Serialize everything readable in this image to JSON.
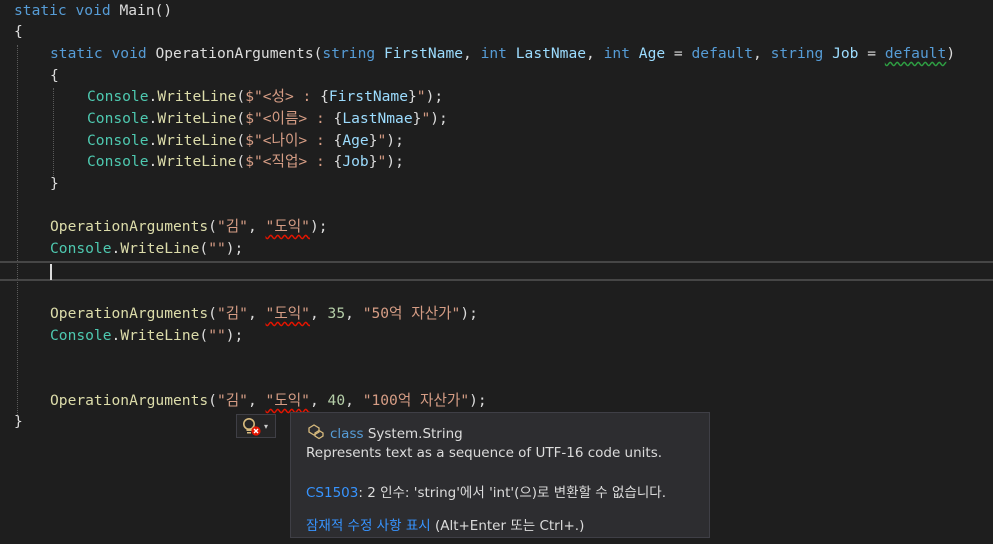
{
  "code": {
    "l1": {
      "static": "static",
      "void": "void",
      "name": "Main",
      "rest": "()"
    },
    "l2": {
      "brace": "{"
    },
    "l3": {
      "static": "static",
      "void": "void",
      "name": "OperationArguments",
      "p0": "(",
      "t1": "string",
      "n1": "FirstName",
      "c1": ", ",
      "t2": "int",
      "n2": "LastNmae",
      "c2": ", ",
      "t3": "int",
      "n3": "Age",
      "eq1": " = ",
      "d1": "default",
      "c3": ", ",
      "t4": "string",
      "n4": "Job",
      "eq2": " = ",
      "d2": "default",
      "p1": ")"
    },
    "l4": {
      "brace": "{"
    },
    "l5": {
      "cls": "Console",
      "dot": ".",
      "m": "WriteLine",
      "open": "(",
      "s1": "$\"<성> : ",
      "lb": "{",
      "v": "FirstName",
      "rb": "}",
      "s2": "\"",
      "close": ");"
    },
    "l6": {
      "cls": "Console",
      "dot": ".",
      "m": "WriteLine",
      "open": "(",
      "s1": "$\"<이름> : ",
      "lb": "{",
      "v": "LastNmae",
      "rb": "}",
      "s2": "\"",
      "close": ");"
    },
    "l7": {
      "cls": "Console",
      "dot": ".",
      "m": "WriteLine",
      "open": "(",
      "s1": "$\"<나이> : ",
      "lb": "{",
      "v": "Age",
      "rb": "}",
      "s2": "\"",
      "close": ");"
    },
    "l8": {
      "cls": "Console",
      "dot": ".",
      "m": "WriteLine",
      "open": "(",
      "s1": "$\"<직업> : ",
      "lb": "{",
      "v": "Job",
      "rb": "}",
      "s2": "\"",
      "close": ");"
    },
    "l9": {
      "brace": "}"
    },
    "l11": {
      "fn": "OperationArguments",
      "open": "(",
      "a1": "\"김\"",
      "c1": ", ",
      "a2": "\"도익\"",
      "close": ");"
    },
    "l12": {
      "cls": "Console",
      "dot": ".",
      "m": "WriteLine",
      "open": "(",
      "a1": "\"\"",
      "close": ");"
    },
    "l15": {
      "fn": "OperationArguments",
      "open": "(",
      "a1": "\"김\"",
      "c1": ", ",
      "a2": "\"도익\"",
      "c2": ", ",
      "n": "35",
      "c3": ", ",
      "a3": "\"50억 자산가\"",
      "close": ");"
    },
    "l16": {
      "cls": "Console",
      "dot": ".",
      "m": "WriteLine",
      "open": "(",
      "a1": "\"\"",
      "close": ");"
    },
    "l19": {
      "fn": "OperationArguments",
      "open": "(",
      "a1": "\"김\"",
      "c1": ", ",
      "a2": "\"도익\"",
      "c2": ", ",
      "n": "40",
      "c3": ", ",
      "a3": "\"100억 자산가\"",
      "close": ");"
    },
    "l20": {
      "brace": "}"
    }
  },
  "quick_actions": {
    "icon": "lightbulb-error-icon",
    "dropdown": "▾"
  },
  "tooltip": {
    "icon": "class-icon",
    "kind": "class",
    "type_name": "System.String",
    "description": "Represents text as a sequence of UTF-16 code units.",
    "error_code": "CS1503",
    "error_text": ": 2 인수: 'string'에서 'int'(으)로 변환할 수 없습니다.",
    "fix_link": "잠재적 수정 사항 표시",
    "fix_hint": " (Alt+Enter 또는 Ctrl+.)"
  },
  "colors": {
    "background": "#1e1e1e",
    "keyword": "#569cd6",
    "type": "#4ec9b0",
    "method": "#dcdcaa",
    "param": "#9cdcfe",
    "string": "#d69d85",
    "number": "#b5cea8",
    "link": "#3794ff",
    "error": "#e51400"
  }
}
